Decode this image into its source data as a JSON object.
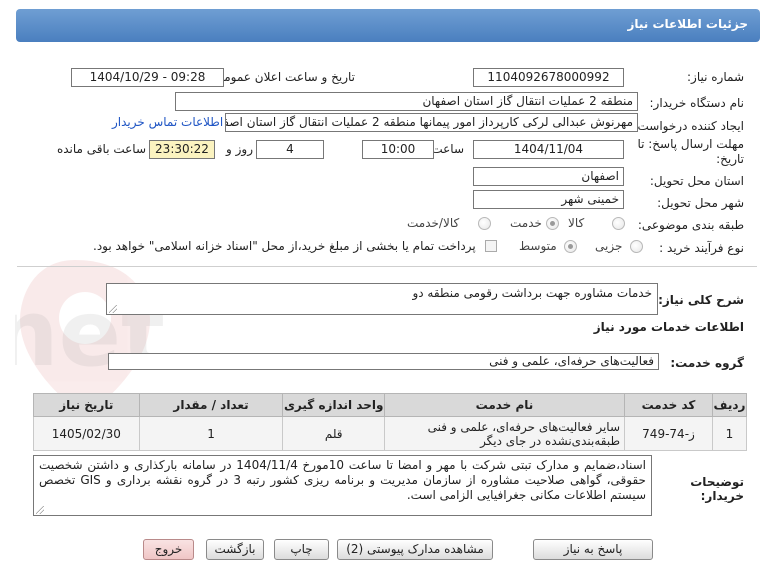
{
  "header": {
    "title": "جزئیات اطلاعات نیاز"
  },
  "watermark": {
    "text": "AriaTender.net"
  },
  "form": {
    "need_number_label": "شماره نیاز:",
    "need_number": "1104092678000992",
    "announce_label": "تاریخ و ساعت اعلان عمومی:",
    "announce_value": "1404/10/29 - 09:28",
    "buyer_org_label": "نام دستگاه خریدار:",
    "buyer_org": "منطقه 2 عملیات انتقال گاز استان اصفهان",
    "requester_label": "ایجاد کننده درخواست:",
    "requester": "مهرنوش عبدالی لرکی کارپرداز امور پیمانها منطقه 2 عملیات انتقال گاز استان اصفهان",
    "contact_link": "اطلاعات تماس خریدار",
    "deadline_label_1": "مهلت ارسال پاسخ: تا",
    "deadline_label_2": "تاریخ:",
    "deadline_date": "1404/11/04",
    "time_label": "ساعت",
    "deadline_time": "10:00",
    "days_value": "4",
    "days_label": "روز و",
    "remaining_time": "23:30:22",
    "remaining_label": "ساعت باقی مانده",
    "province_label": "استان محل تحویل:",
    "province": "اصفهان",
    "city_label": "شهر محل تحویل:",
    "city": "خمینی شهر",
    "category_label": "طبقه بندی موضوعی:",
    "category_options": [
      "کالا",
      "خدمت",
      "کالا/خدمت"
    ],
    "category_selected": "خدمت",
    "process_label": "نوع فرآیند خرید :",
    "process_options": [
      "جزیی",
      "متوسط"
    ],
    "process_selected": "جزیی",
    "payment_note": "پرداخت تمام یا بخشی از مبلغ خرید،از محل \"اسناد خزانه اسلامی\" خواهد بود."
  },
  "summary": {
    "label": "شرح کلی نیاز:",
    "text": "خدمات مشاوره جهت برداشت رقومی منطقه دو"
  },
  "services": {
    "section_title": "اطلاعات خدمات مورد نیاز",
    "group_label": "گروه خدمت:",
    "group_value": "فعالیت‌های حرفه‌ای، علمی و فنی"
  },
  "table": {
    "headers": [
      "ردیف",
      "کد خدمت",
      "نام خدمت",
      "واحد اندازه گیری",
      "تعداد / مقدار",
      "تاریخ نیاز"
    ],
    "rows": [
      [
        "1",
        "ز-74-749",
        "سایر فعالیت‌های حرفه‌ای، علمی و فنی طبقه‌بندی‌نشده در جای دیگر",
        "قلم",
        "1",
        "1405/02/30"
      ]
    ]
  },
  "notes": {
    "label_1": "توضیحات",
    "label_2": "خریدار:",
    "text": "اسناد،ضمایم و مدارک تبتی شرکت با مهر و امضا تا ساعت 10مورخ 1404/11/4 در سامانه بارکذاری و داشتن شخصیت حقوقی، گواهی صلاحیت مشاوره از سازمان مدیریت و برنامه ریزی کشور رتبه 3 در گروه نقشه برداری و GIS تخصص سیستم اطلاعات مکانی جغرافیایی الزامی است."
  },
  "buttons": {
    "reply": "پاسخ به نیاز",
    "attachments": "مشاهده مدارک پیوستی (2)",
    "print": "چاپ",
    "back": "بازگشت",
    "exit": "خروج"
  }
}
